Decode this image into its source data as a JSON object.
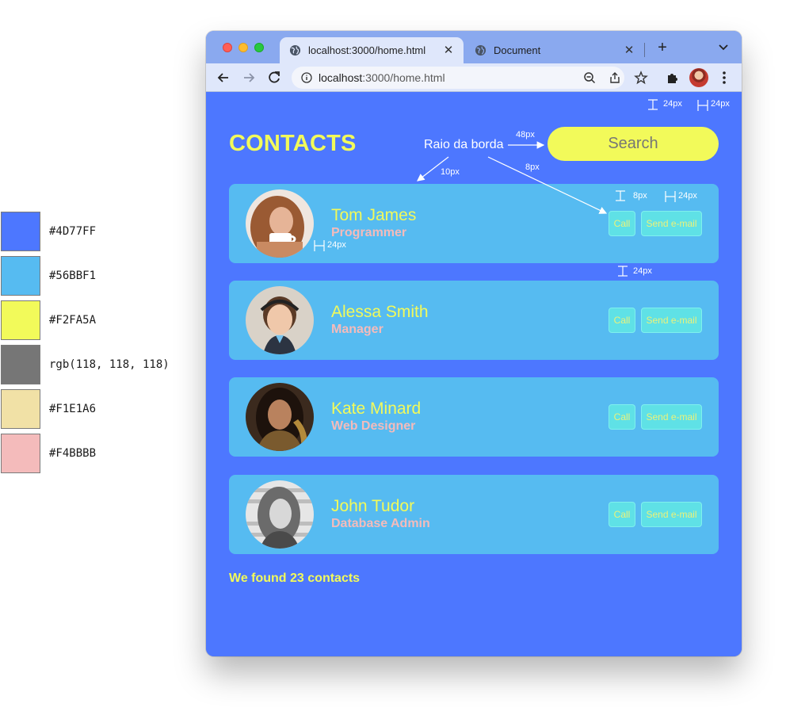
{
  "palette": [
    {
      "color": "#4D77FF",
      "label": "#4D77FF"
    },
    {
      "color": "#56BBF1",
      "label": "#56BBF1"
    },
    {
      "color": "#F2FA5A",
      "label": "#F2FA5A"
    },
    {
      "color": "rgb(118, 118, 118)",
      "label": "rgb(118, 118, 118)"
    },
    {
      "color": "#F1E1A6",
      "label": "#F1E1A6"
    },
    {
      "color": "#F4BBBB",
      "label": "#F4BBBB"
    }
  ],
  "browser": {
    "tabs": [
      {
        "title": "localhost:3000/home.html",
        "active": true
      },
      {
        "title": "Document",
        "active": false
      }
    ],
    "url_host": "localhost",
    "url_rest": ":3000/home.html"
  },
  "page": {
    "title": "CONTACTS",
    "search_label": "Search",
    "footer": "We found 23 contacts",
    "call_label": "Call",
    "email_label": "Send e-mail",
    "contacts": [
      {
        "name": "Tom James",
        "role": "Programmer"
      },
      {
        "name": "Alessa Smith",
        "role": "Manager"
      },
      {
        "name": "Kate Minard",
        "role": "Web Designer"
      },
      {
        "name": "John Tudor",
        "role": "Database Admin"
      }
    ]
  },
  "annotations": {
    "border_radius": "Raio da borda",
    "top_24": "24px",
    "right_24": "24px",
    "search_gap": "48px",
    "radius_10": "10px",
    "radius_8": "8px",
    "btn_top_8": "8px",
    "btn_right_24": "24px",
    "avatar_gap_24": "24px",
    "card_gap_24": "24px"
  },
  "colors": {
    "primary": "#4D77FF",
    "card": "#56BBF1",
    "accent": "#F2FA5A",
    "muted": "#767676",
    "cream": "#F1E1A6",
    "pink": "#F4BBBB"
  }
}
